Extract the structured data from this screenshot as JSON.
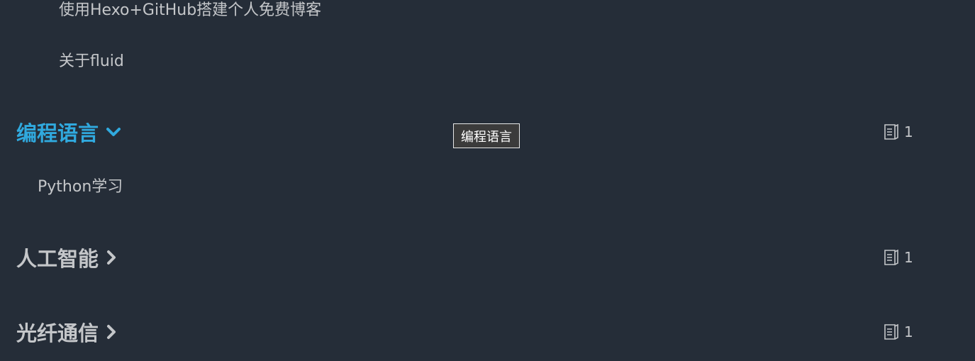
{
  "posts_top": [
    {
      "title": "使用Hexo+GitHub搭建个人免费博客"
    },
    {
      "title": "关于fluid"
    }
  ],
  "categories": [
    {
      "name": "编程语言",
      "count": "1",
      "expanded": true,
      "posts": [
        {
          "title": "Python学习"
        }
      ]
    },
    {
      "name": "人工智能",
      "count": "1",
      "expanded": false
    },
    {
      "name": "光纤通信",
      "count": "1",
      "expanded": false
    }
  ],
  "tooltip": {
    "text": "编程语言"
  },
  "icons": {
    "chevron_down": "chevron-down-icon",
    "chevron_right": "chevron-right-icon",
    "count": "document-icon"
  },
  "colors": {
    "background": "#252d38",
    "text": "#c4c6c9",
    "accent": "#30a9de"
  }
}
